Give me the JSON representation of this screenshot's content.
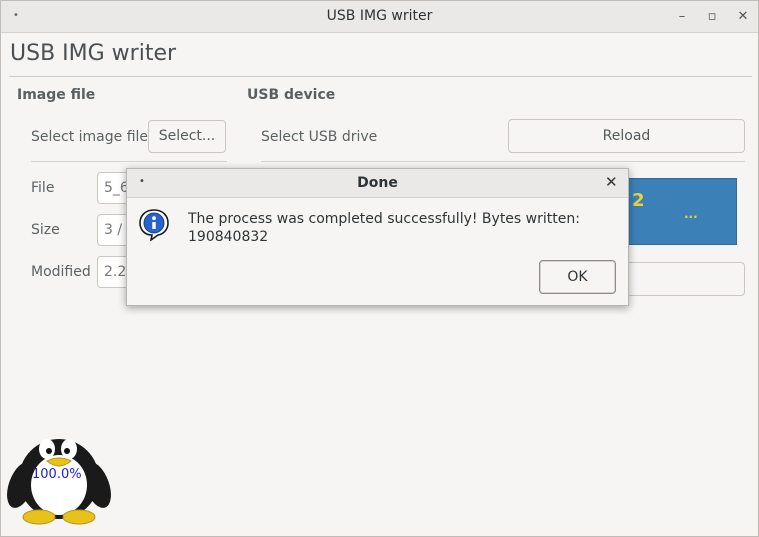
{
  "window": {
    "title": "USB IMG writer",
    "menu_glyph": "•",
    "minimize_glyph": "–",
    "maximize_glyph": "▫",
    "close_glyph": "✕"
  },
  "app": {
    "title": "USB IMG writer"
  },
  "image_file": {
    "section_label": "Image file",
    "select_label": "Select image file",
    "select_button": "Select...",
    "file_label": "File",
    "file_value": "5_6",
    "size_label": "Size",
    "size_value": "3 / 1",
    "modified_label": "Modified",
    "modified_value": "2.2"
  },
  "usb_device": {
    "section_label": "USB device",
    "select_label": "Select USB drive",
    "reload_button": "Reload",
    "device_number": "2",
    "device_more": "..."
  },
  "progress": {
    "text": "100.0%"
  },
  "dialog": {
    "title": "Done",
    "menu_glyph": "•",
    "close_glyph": "✕",
    "message_line1": "The process was completed successfully! Bytes written:",
    "message_line2": "190840832",
    "ok_button": "OK",
    "icon": "info-icon"
  },
  "colors": {
    "device_bg": "#3b81b8",
    "device_text": "#e5d43b",
    "progress_text": "#1d20d8"
  }
}
